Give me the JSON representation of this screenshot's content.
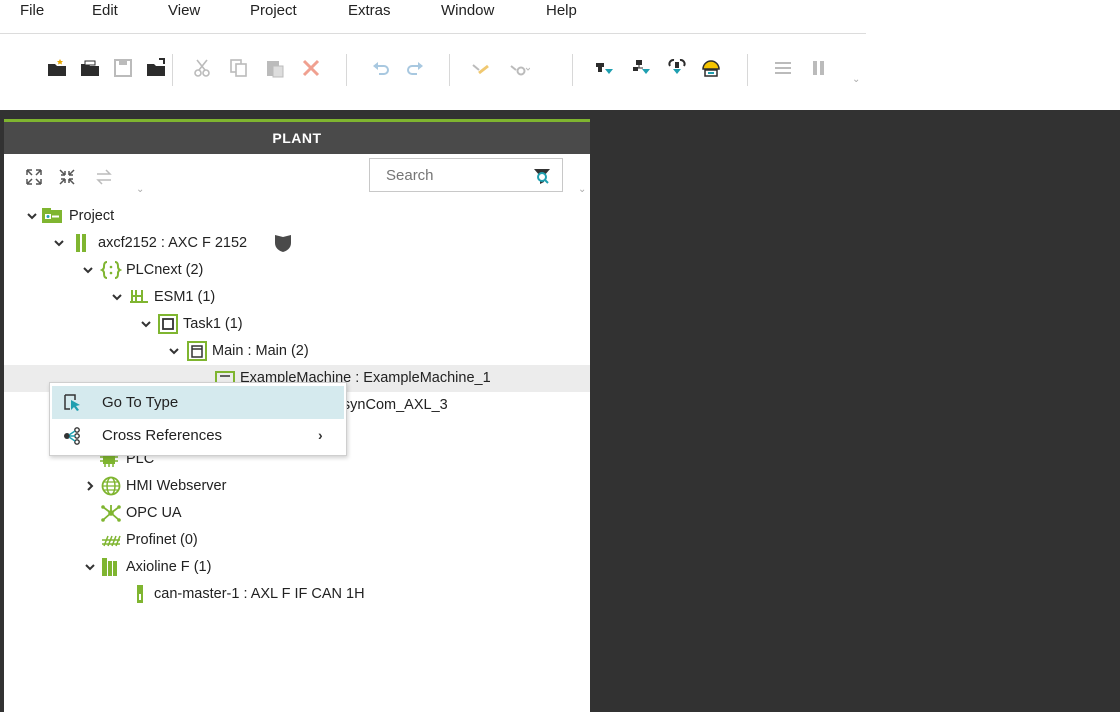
{
  "menu": [
    "File",
    "Edit",
    "View",
    "Project",
    "Extras",
    "Window",
    "Help"
  ],
  "toolbar": {
    "buttons": [
      "new-project-icon",
      "open-project-icon",
      "save-icon",
      "save-as-icon",
      "cut-icon",
      "copy-icon",
      "paste-icon",
      "delete-icon",
      "undo-icon",
      "redo-icon",
      "write-and-start-icon",
      "connect-icon",
      "online-icon",
      "debug-icon",
      "tree-icon",
      "safety-icon",
      "list-icon",
      "pause-icon"
    ]
  },
  "panel": {
    "title": "PLANT",
    "search_placeholder": "Search",
    "accent_color": "#7fb530"
  },
  "tree": [
    {
      "label": "Project",
      "expanded": true
    },
    {
      "label": "axcf2152 : AXC F 2152",
      "expanded": true
    },
    {
      "label": "PLCnext (2)",
      "expanded": true
    },
    {
      "label": "ESM1 (1)",
      "expanded": true
    },
    {
      "label": "Task1 (1)",
      "expanded": true
    },
    {
      "label": "Main : Main (2)",
      "expanded": true
    },
    {
      "label": "ExampleMachine : ExampleMachine_1",
      "selected": true
    },
    {
      "label": ": AsynCom_AXL_3"
    },
    {
      "label": "PLC"
    },
    {
      "label": "HMI Webserver",
      "expanded": false
    },
    {
      "label": "OPC UA"
    },
    {
      "label": "Profinet (0)"
    },
    {
      "label": "Axioline F (1)",
      "expanded": true
    },
    {
      "label": "can-master-1 : AXL F IF CAN 1H"
    }
  ],
  "context_menu": {
    "items": [
      {
        "label": "Go To Type",
        "icon": "go-to-type-icon",
        "active": true
      },
      {
        "label": "Cross References",
        "icon": "cross-references-icon",
        "submenu": true
      }
    ],
    "submenu_arrow": "›"
  }
}
